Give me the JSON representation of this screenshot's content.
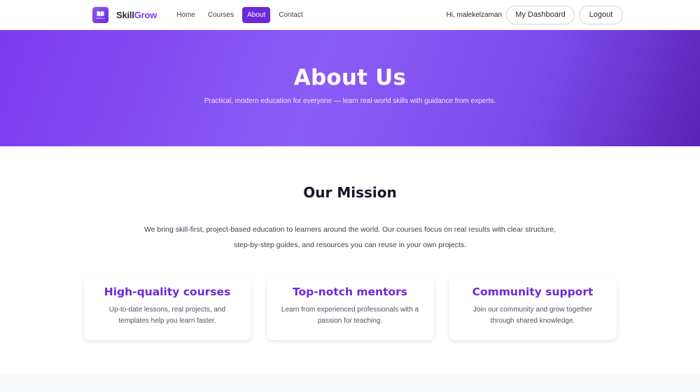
{
  "nav": {
    "brand_skill": "Skill",
    "brand_grow": "Grow",
    "logo_mini_text": "SkillGrow",
    "links": [
      {
        "label": "Home",
        "active": false
      },
      {
        "label": "Courses",
        "active": false
      },
      {
        "label": "About",
        "active": true
      },
      {
        "label": "Contact",
        "active": false
      }
    ],
    "greeting": "Hi, malekelzaman",
    "dashboard_label": "My Dashboard",
    "logout_label": "Logout"
  },
  "hero": {
    "title": "About Us",
    "subtitle": "Practical, modern education for everyone — learn real-world skills with guidance from experts."
  },
  "mission": {
    "title": "Our Mission",
    "text": "We bring skill-first, project-based education to learners around the world. Our courses focus on real results with clear structure, step-by-step guides, and resources you can reuse in your own projects."
  },
  "cards": [
    {
      "title": "High-quality courses",
      "text": "Up-to-date lessons, real projects, and templates help you learn faster."
    },
    {
      "title": "Top-notch mentors",
      "text": "Learn from experienced professionals with a passion for teaching."
    },
    {
      "title": "Community support",
      "text": "Join our community and grow together through shared knowledge."
    }
  ],
  "colors": {
    "accent": "#6d28d9",
    "hero_start": "#7c3aed",
    "hero_end": "#5b21b6"
  },
  "icons": {
    "logo": "book-icon"
  }
}
